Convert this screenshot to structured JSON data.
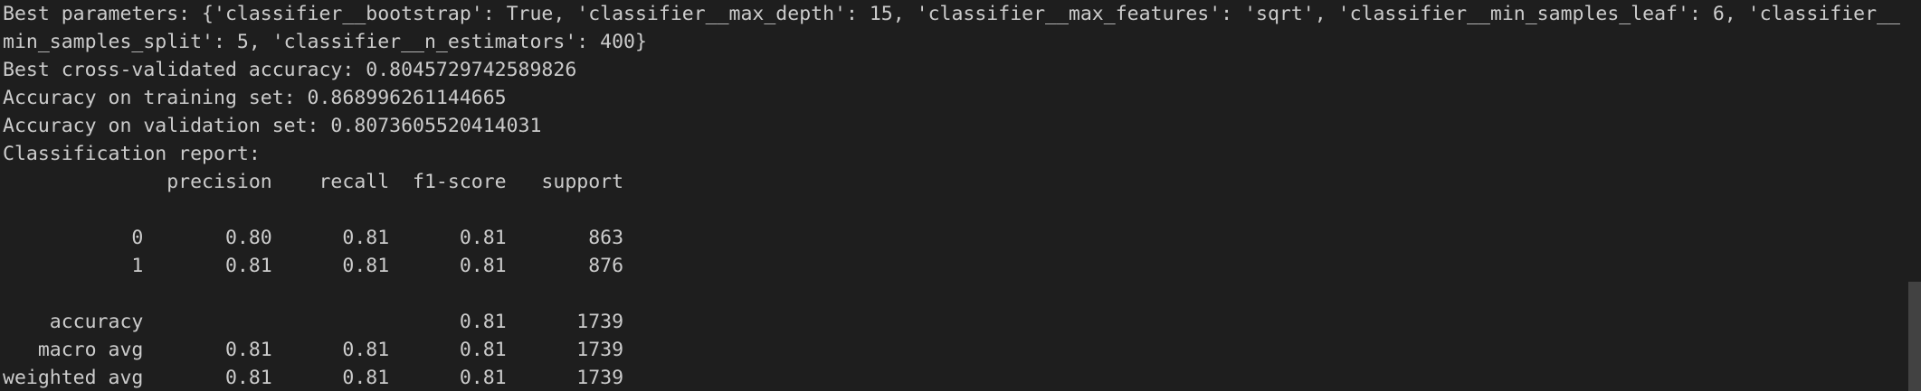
{
  "terminal": {
    "lines": [
      "Best parameters: {'classifier__bootstrap': True, 'classifier__max_depth': 15, 'classifier__max_features': 'sqrt', 'classifier__min_samples_leaf': 6, 'classifier__",
      "min_samples_split': 5, 'classifier__n_estimators': 400}",
      "Best cross-validated accuracy: 0.8045729742589826",
      "Accuracy on training set: 0.868996261144665",
      "Accuracy on validation set: 0.8073605520414031",
      "Classification report:",
      "              precision    recall  f1-score   support",
      "",
      "           0       0.80      0.81      0.81       863",
      "           1       0.81      0.81      0.81       876",
      "",
      "    accuracy                           0.81      1739",
      "   macro avg       0.81      0.81      0.81      1739",
      "weighted avg       0.81      0.81      0.81      1739"
    ]
  }
}
